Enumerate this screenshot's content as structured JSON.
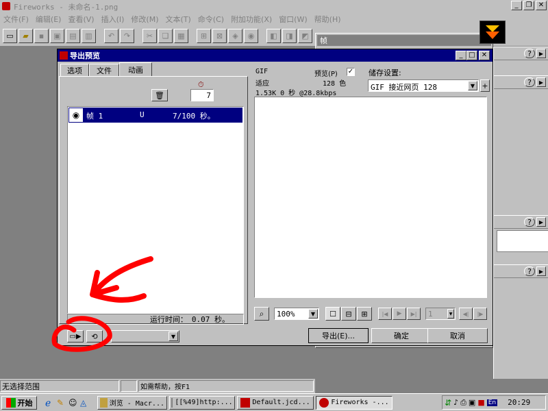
{
  "app": {
    "title": "Fireworks - 未命名-1.png",
    "menu": [
      "文件(F)",
      "编辑(E)",
      "查看(V)",
      "插入(I)",
      "修改(M)",
      "文本(T)",
      "命令(C)",
      "附加功能(X)",
      "窗口(W)",
      "帮助(H)"
    ],
    "controls": [
      "_",
      "❐",
      "✕"
    ]
  },
  "frame_window": {
    "title": "帧",
    "help": "?",
    "arrow": "▶"
  },
  "dialog": {
    "title": "导出预览",
    "tabs": [
      "选项",
      "文件",
      "动画"
    ],
    "active_tab": "动画",
    "delay_value": "7",
    "frames": [
      {
        "name": "帧 1",
        "disposal": "U",
        "delay": "7/100 秒。"
      }
    ],
    "runtime_label": "运行时间：",
    "runtime_value": "0.07 秒。",
    "preview_info": {
      "format": "GIF",
      "preview_label": "预览(P)",
      "preview_checked": "✓",
      "fit": "适应",
      "colors": "128 色",
      "size_time": "1.53K  0 秒 @28.8kbps"
    },
    "saved_settings_label": "储存设置:",
    "saved_settings_value": "GIF 接近网页 128",
    "add_btn": "+",
    "zoom_value": "100%",
    "frame_field": "1",
    "buttons": {
      "export": "导出(E)...",
      "ok": "确定",
      "cancel": "取消"
    }
  },
  "statusbar": {
    "left": "无选择范围",
    "right": "如需帮助，按F1"
  },
  "taskbar": {
    "start": "开始",
    "tasks": [
      "浏览 - Macr...",
      "[[%49]http:...",
      "Default.jcd...",
      "Fireworks -..."
    ],
    "lang": "En",
    "clock": "20:29"
  },
  "colors": {
    "title_active": "#000080",
    "selection": "#000080",
    "annotation": "#ff0000"
  }
}
